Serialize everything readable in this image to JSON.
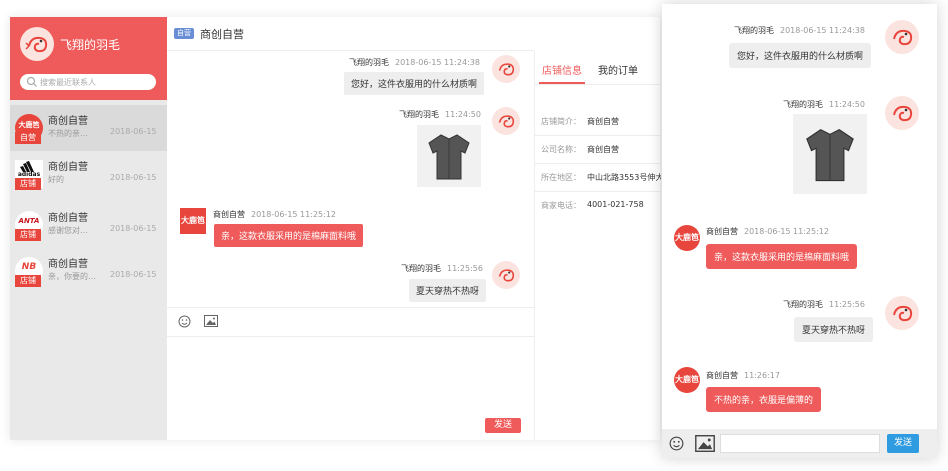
{
  "sidebar": {
    "username": "飞翔的羽毛",
    "search_placeholder": "搜索最近联系人",
    "contacts": [
      {
        "name": "商创自营",
        "logo": "大鹿笆",
        "badge": "自营",
        "preview": "不热的亲...",
        "date": "2018-06-15"
      },
      {
        "name": "商创自营",
        "logo": "adidas",
        "badge": "店铺",
        "preview": "好的",
        "date": "2018-06-15"
      },
      {
        "name": "商创自营",
        "logo": "ANTA",
        "badge": "店铺",
        "preview": "感谢您对...",
        "date": "2018-06-15"
      },
      {
        "name": "商创自营",
        "logo": "NB",
        "badge": "店铺",
        "preview": "亲，你要的...",
        "date": "2018-06-15"
      }
    ]
  },
  "chat": {
    "tag": "自营",
    "title": "商创自营",
    "store_logo_text": "大鹿笆",
    "messages": [
      {
        "sender": "飞翔的羽毛",
        "time": "2018-06-15 11:24:38",
        "text": "您好，这件衣服用的什么材质啊"
      },
      {
        "sender": "飞翔的羽毛",
        "time": "11:24:50",
        "image": "shirt-image"
      },
      {
        "sender": "商创自营",
        "time": "2018-06-15 11:25:12",
        "text": "亲，这款衣服采用的是棉麻面料哦"
      },
      {
        "sender": "飞翔的羽毛",
        "time": "11:25:56",
        "text": "夏天穿热不热呀"
      }
    ],
    "send_label": "发送"
  },
  "info": {
    "tabs": [
      "店铺信息",
      "我的订单"
    ],
    "rows": [
      {
        "label": "店铺简介：",
        "value": "商创自营"
      },
      {
        "label": "公司名称：",
        "value": "商创自营"
      },
      {
        "label": "所在地区：",
        "value": "中山北路3553号伸大"
      },
      {
        "label": "商家电话：",
        "value": "4001-021-758"
      }
    ]
  },
  "mobile": {
    "store_logo_text": "大鹿笆",
    "messages": [
      {
        "sender": "飞翔的羽毛",
        "time": "2018-06-15 11:24:38",
        "text": "您好，这件衣服用的什么材质啊"
      },
      {
        "sender": "飞翔的羽毛",
        "time": "11:24:50",
        "image": "shirt-image"
      },
      {
        "sender": "商创自营",
        "time": "2018-06-15 11:25:12",
        "text": "亲，这款衣服采用的是棉麻面料哦"
      },
      {
        "sender": "飞翔的羽毛",
        "time": "11:25:56",
        "text": "夏天穿热不热呀"
      },
      {
        "sender": "商创自营",
        "time": "11:26:17",
        "text": "不热的亲，衣服是偏薄的"
      }
    ],
    "send_label": "发送"
  },
  "colors": {
    "brand_red": "#ef5b5b",
    "send_blue": "#2f9be0",
    "store_red": "#e8453c"
  }
}
